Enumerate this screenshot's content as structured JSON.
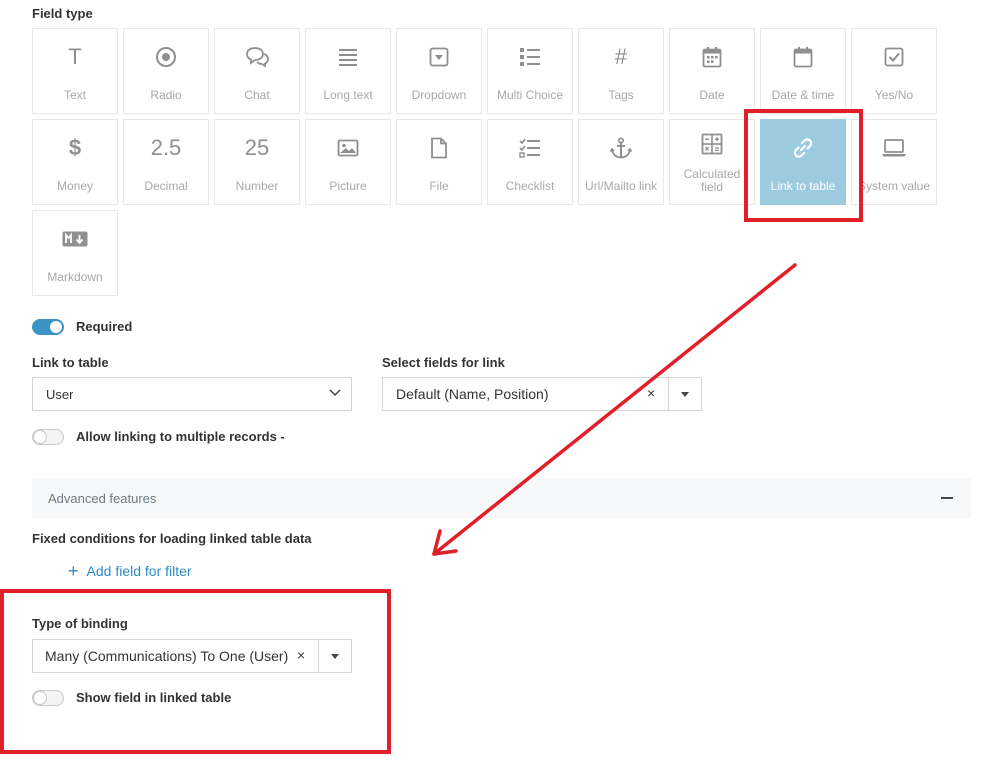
{
  "field_type": {
    "label": "Field type",
    "tiles": [
      {
        "name": "Text",
        "icon": "T"
      },
      {
        "name": "Radio",
        "icon": "radio-icon"
      },
      {
        "name": "Chat",
        "icon": "chat-icon"
      },
      {
        "name": "Long text",
        "icon": "long-text-icon"
      },
      {
        "name": "Dropdown",
        "icon": "dropdown-icon"
      },
      {
        "name": "Multi Choice",
        "icon": "multi-choice-icon"
      },
      {
        "name": "Tags",
        "icon": "#"
      },
      {
        "name": "Date",
        "icon": "calendar-icon"
      },
      {
        "name": "Date & time",
        "icon": "calendar-time-icon"
      },
      {
        "name": "Yes/No",
        "icon": "checkbox-icon"
      },
      {
        "name": "Money",
        "icon": "$"
      },
      {
        "name": "Decimal",
        "icon": "2.5"
      },
      {
        "name": "Number",
        "icon": "25"
      },
      {
        "name": "Picture",
        "icon": "picture-icon"
      },
      {
        "name": "File",
        "icon": "file-icon"
      },
      {
        "name": "Checklist",
        "icon": "checklist-icon"
      },
      {
        "name": "Url/Mailto link",
        "icon": "anchor-icon"
      },
      {
        "name": "Calculated field",
        "icon": "calculator-icon"
      },
      {
        "name": "Link to table",
        "icon": "link-icon"
      },
      {
        "name": "System value",
        "icon": "laptop-icon"
      },
      {
        "name": "Markdown",
        "icon": "markdown-icon"
      }
    ],
    "selected": "Link to table"
  },
  "required": {
    "label": "Required",
    "on": true
  },
  "link_to_table": {
    "label": "Link to table",
    "value": "User"
  },
  "select_fields": {
    "label": "Select fields for link",
    "value": "Default (Name, Position)",
    "clear": "×"
  },
  "allow_multiple": {
    "label": "Allow linking to multiple records -",
    "on": false
  },
  "advanced": {
    "label": "Advanced features"
  },
  "fixed_conditions": {
    "label": "Fixed conditions for loading linked table data"
  },
  "add_filter": {
    "plus": "+",
    "label": "Add field for filter"
  },
  "binding": {
    "label": "Type of binding",
    "value": "Many (Communications) To One (User)",
    "clear": "×"
  },
  "show_linked": {
    "label": "Show field in linked table",
    "on": false
  },
  "colors": {
    "accent": "#3b95c4",
    "selected_tile": "#9ccbe0",
    "annotation": "#e02029"
  }
}
